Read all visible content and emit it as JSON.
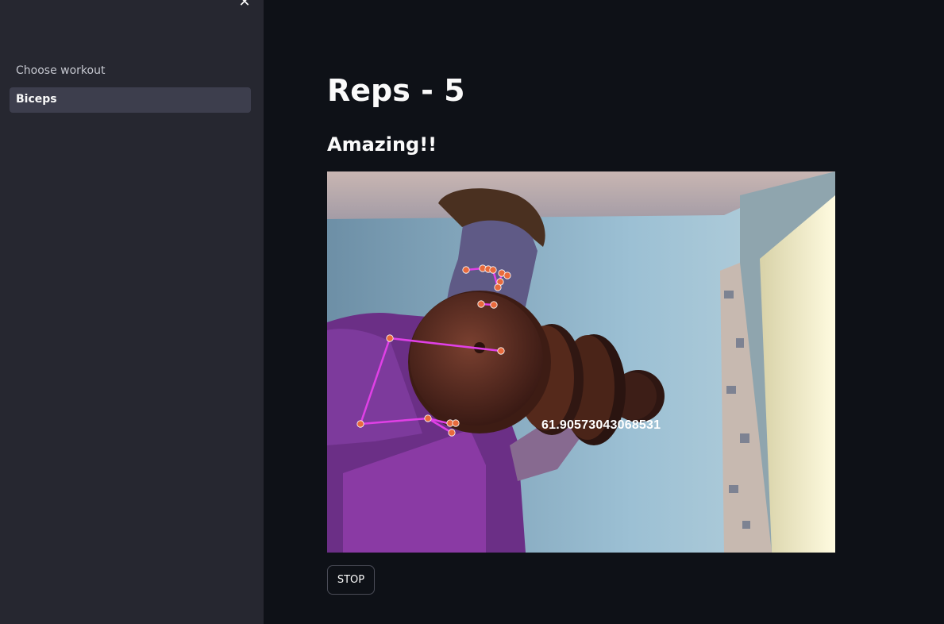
{
  "sidebar": {
    "close_label": "✕",
    "choose_label": "Choose workout",
    "selected_workout": "Biceps"
  },
  "main": {
    "title": "Reps - 5",
    "feedback": "Amazing!!",
    "angle_readout": "61.90573043068531",
    "stop_label": "STOP"
  },
  "colors": {
    "app_bg": "#0e1117",
    "sidebar_bg": "#262730",
    "selected_bg": "#3d3e4d",
    "pose_line": "#e040e6",
    "pose_point": "#e86a3c"
  }
}
